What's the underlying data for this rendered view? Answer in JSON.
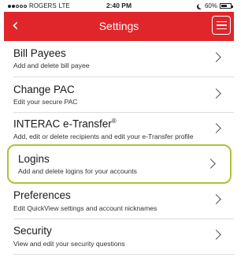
{
  "status_bar": {
    "carrier": "ROGERS",
    "network": "LTE",
    "time": "2:40 PM",
    "battery": "60%"
  },
  "nav": {
    "back_icon": "chevron-left-icon",
    "title": "Settings",
    "menu_icon": "hamburger-menu-icon"
  },
  "items": [
    {
      "label": "Bill Payees",
      "desc": "Add and delete bill payee"
    },
    {
      "label": "Change PAC",
      "desc": "Edit your secure PAC"
    },
    {
      "label": "INTERAC e-Transfer",
      "sup": "®",
      "desc": "Add, edit or delete recipients and edit your e-Transfer profile"
    },
    {
      "label": "Logins",
      "desc": "Add and delete logins for your accounts"
    },
    {
      "label": "Preferences",
      "desc": "Edit QuickView settings and account nicknames"
    },
    {
      "label": "Security",
      "desc": "View and edit your security questions"
    }
  ],
  "highlight_color": "#a8c53a",
  "brand_color": "#e0262a"
}
